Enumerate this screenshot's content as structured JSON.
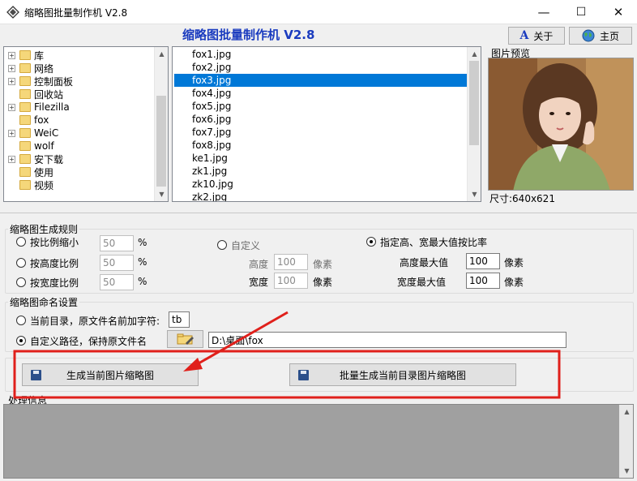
{
  "window": {
    "title": "缩略图批量制作机 V2.8",
    "min_glyph": "—",
    "max_glyph": "☐",
    "close_glyph": "✕"
  },
  "header": {
    "app_title": "缩略图批量制作机  V2.8",
    "about_label": "关于",
    "home_label": "主页"
  },
  "folder_tree": [
    {
      "label": "库",
      "expandable": true
    },
    {
      "label": "网络",
      "expandable": true
    },
    {
      "label": "控制面板",
      "expandable": true
    },
    {
      "label": "回收站",
      "expandable": false
    },
    {
      "label": "Filezilla",
      "expandable": true
    },
    {
      "label": "fox",
      "expandable": false
    },
    {
      "label": "WeiC",
      "expandable": true
    },
    {
      "label": "wolf",
      "expandable": false
    },
    {
      "label": "安下载",
      "expandable": true
    },
    {
      "label": "使用",
      "expandable": false
    },
    {
      "label": "视频",
      "expandable": false
    }
  ],
  "file_list": {
    "items": [
      "fox1.jpg",
      "fox2.jpg",
      "fox3.jpg",
      "fox4.jpg",
      "fox5.jpg",
      "fox6.jpg",
      "fox7.jpg",
      "fox8.jpg",
      "ke1.jpg",
      "zk1.jpg",
      "zk10.jpg",
      "zk2.jpg"
    ],
    "selected": "fox3.jpg"
  },
  "preview": {
    "label": "图片预览",
    "size_text": "尺寸:640x621"
  },
  "rules": {
    "title": "缩略图生成规则",
    "scale_label": "按比例缩小",
    "scale_value": "50",
    "height_ratio_label": "按高度比例",
    "height_ratio_value": "50",
    "width_ratio_label": "按宽度比例",
    "width_ratio_value": "50",
    "percent": "%",
    "custom_label": "自定义",
    "height_label": "高度",
    "height_value": "100",
    "width_label": "宽度",
    "width_value": "100",
    "px": "像素",
    "max_label": "指定高、宽最大值按比率",
    "max_height_label": "高度最大值",
    "max_height_value": "100",
    "max_width_label": "宽度最大值",
    "max_width_value": "100",
    "selected_option": "max"
  },
  "naming": {
    "title": "缩略图命名设置",
    "prefix_label": "当前目录，原文件名前加字符:",
    "prefix_value": "tb",
    "custom_path_label": "自定义路径，保持原文件名",
    "path_value": "D:\\桌面\\fox",
    "selected_option": "custom_path"
  },
  "actions": {
    "generate_current": "生成当前图片缩略图",
    "generate_batch": "批量生成当前目录图片缩略图"
  },
  "log": {
    "title": "处理信息"
  },
  "colors": {
    "selection": "#0078d7",
    "title_blue": "#1a3bbf",
    "annotation_red": "#e0201b"
  }
}
